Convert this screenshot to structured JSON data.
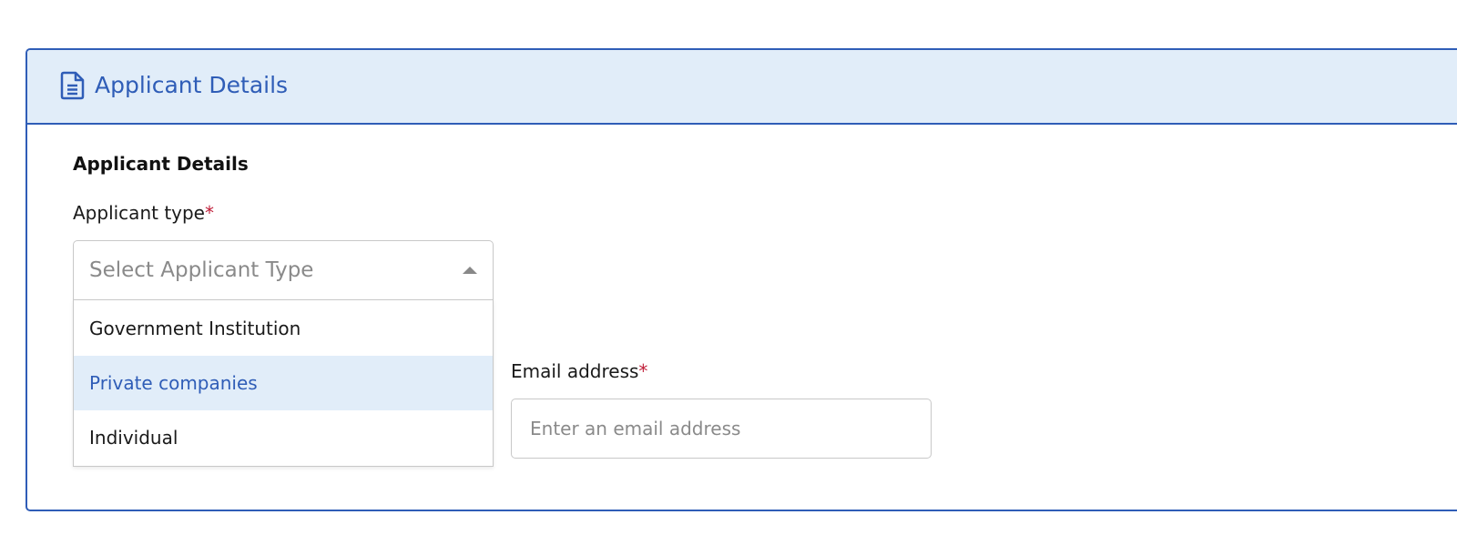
{
  "card": {
    "header_title": "Applicant Details",
    "header_icon": "document-icon"
  },
  "section": {
    "title": "Applicant Details"
  },
  "applicant_type": {
    "label": "Applicant type",
    "required_mark": "*",
    "placeholder": "Select Applicant Type",
    "expanded": true,
    "options": [
      {
        "label": "Government Institution",
        "highlighted": false
      },
      {
        "label": "Private companies",
        "highlighted": true
      },
      {
        "label": "Individual",
        "highlighted": false
      }
    ]
  },
  "email": {
    "label": "Email address",
    "required_mark": "*",
    "value": "",
    "placeholder": "Enter an email address"
  },
  "colors": {
    "accent": "#2f5db7",
    "header_bg": "#e1edf9",
    "required": "#c0203a"
  }
}
